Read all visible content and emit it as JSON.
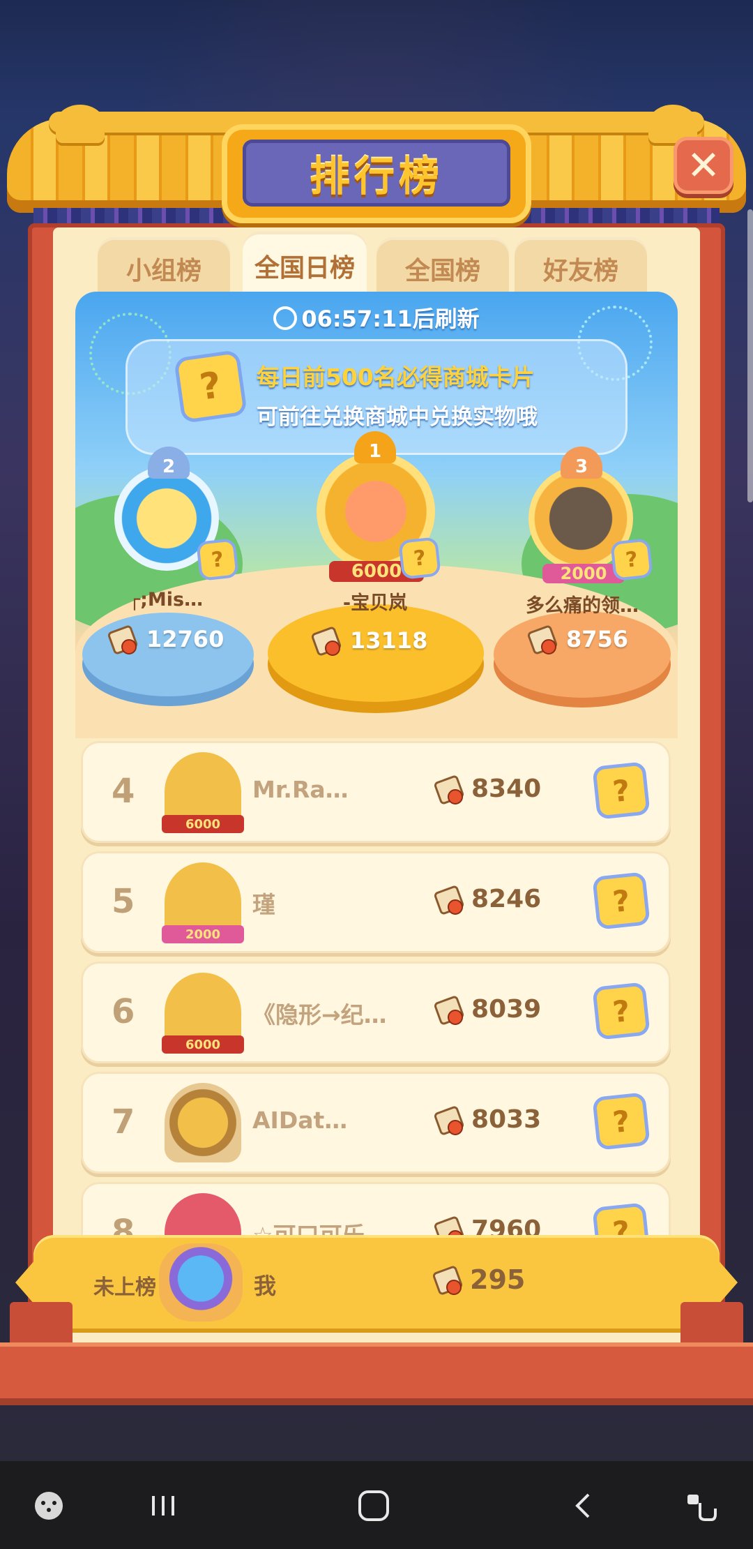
{
  "title": "排行榜",
  "close_label": "✕",
  "tabs": [
    {
      "label": "小组榜",
      "active": false
    },
    {
      "label": "全国日榜",
      "active": true
    },
    {
      "label": "全国榜",
      "active": false
    },
    {
      "label": "好友榜",
      "active": false
    }
  ],
  "refresh": "06:57:11后刷新",
  "banner": {
    "line1": "每日前500名必得商城卡片",
    "line2": "可前往兑换商城中兑换实物哦",
    "card_symbol": "?"
  },
  "podium": [
    {
      "rank": "2",
      "name": "┌;Mis…",
      "score": "12760",
      "badge": ""
    },
    {
      "rank": "1",
      "name": "-宝贝岚",
      "score": "13118",
      "badge": "6000"
    },
    {
      "rank": "3",
      "name": "多么痛的领…",
      "score": "8756",
      "badge": "2000"
    }
  ],
  "rows": [
    {
      "rank": "4",
      "name": "Mr.Ra…",
      "score": "8340",
      "badge": "6000",
      "badge_color": "#c8362b"
    },
    {
      "rank": "5",
      "name": "瑾",
      "score": "8246",
      "badge": "2000",
      "badge_color": "#e05a9a"
    },
    {
      "rank": "6",
      "name": "《隐形→纪…",
      "score": "8039",
      "badge": "6000",
      "badge_color": "#c8362b"
    },
    {
      "rank": "7",
      "name": "AIDat…",
      "score": "8033",
      "badge": "",
      "badge_color": ""
    },
    {
      "rank": "8",
      "name": "☆可口可乐",
      "score": "7960",
      "badge": "",
      "badge_color": ""
    }
  ],
  "me": {
    "rank": "未上榜",
    "name": "我",
    "score": "295"
  },
  "question_symbol": "?",
  "colors": {
    "accent": "#f6a918",
    "frame": "#d2553c",
    "sky": "#4aa6ef"
  },
  "icons": {
    "card": "question-card-icon",
    "coin": "paint-coin-icon",
    "clock": "clock-icon"
  }
}
